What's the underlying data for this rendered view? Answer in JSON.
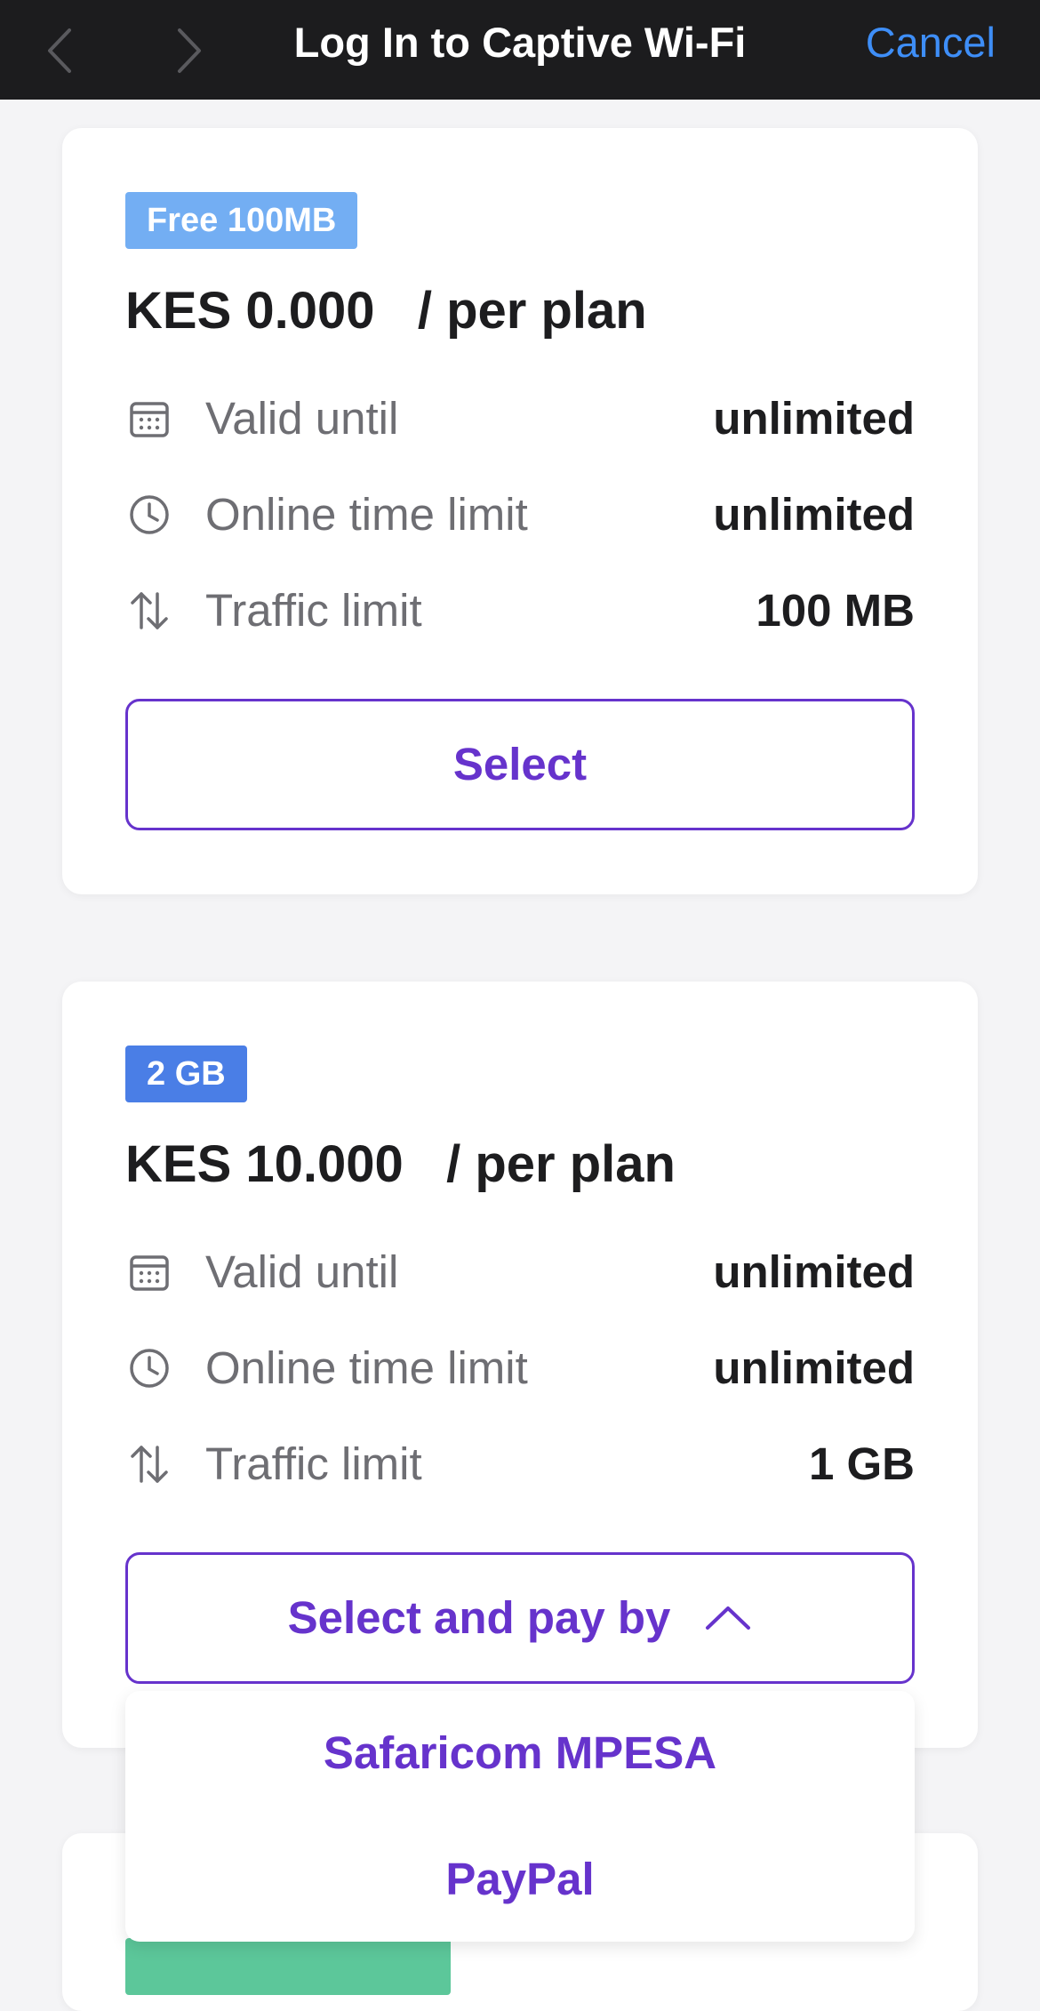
{
  "navbar": {
    "title": "Log In to Captive Wi-Fi",
    "cancel_label": "Cancel",
    "back_icon": "chevron-left-icon",
    "forward_icon": "chevron-right-icon"
  },
  "plans": [
    {
      "badge": "Free 100MB",
      "badge_color": "#73aef3",
      "price": "KES 0.000   / per plan",
      "rows": [
        {
          "icon": "calendar-icon",
          "label": "Valid until",
          "value": "unlimited"
        },
        {
          "icon": "clock-icon",
          "label": "Online time limit",
          "value": "unlimited"
        },
        {
          "icon": "up-down-arrows-icon",
          "label": "Traffic limit",
          "value": "100 MB"
        }
      ],
      "button_label": "Select"
    },
    {
      "badge": "2 GB",
      "badge_color": "#4a7ee6",
      "price": "KES 10.000   / per plan",
      "rows": [
        {
          "icon": "calendar-icon",
          "label": "Valid until",
          "value": "unlimited"
        },
        {
          "icon": "clock-icon",
          "label": "Online time limit",
          "value": "unlimited"
        },
        {
          "icon": "up-down-arrows-icon",
          "label": "Traffic limit",
          "value": "1 GB"
        }
      ],
      "button_label": "Select and pay by",
      "button_icon": "chevron-up-icon"
    }
  ],
  "payment_menu": {
    "options": [
      "Safaricom MPESA",
      "PayPal"
    ]
  },
  "colors": {
    "accent": "#6633cc",
    "link": "#3e8ef7",
    "nav_background": "#1c1c1e",
    "third_plan_badge": "#5cc79a"
  }
}
